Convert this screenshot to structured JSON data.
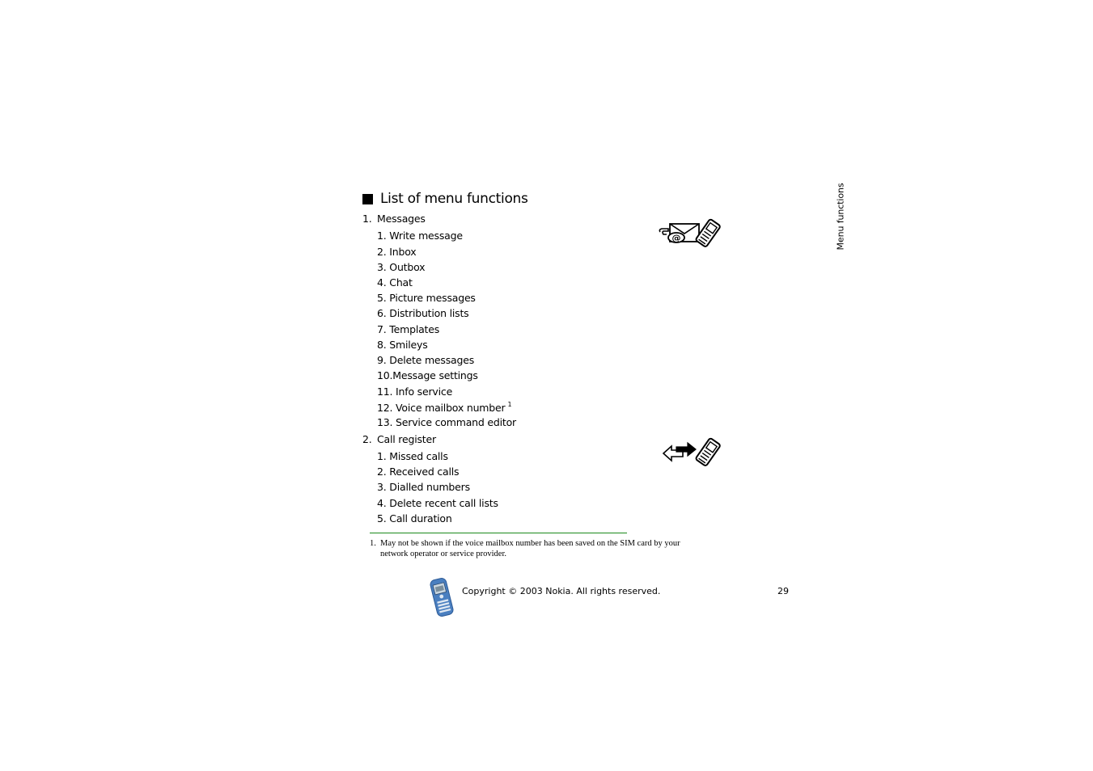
{
  "heading": "List of menu functions",
  "side_tab": "Menu functions",
  "sections": [
    {
      "number": "1.",
      "title": "Messages",
      "icon": "messages-envelope-phone-icon",
      "items": [
        {
          "label": "1. Write message"
        },
        {
          "label": "2. Inbox"
        },
        {
          "label": "3. Outbox"
        },
        {
          "label": "4. Chat"
        },
        {
          "label": "5. Picture messages"
        },
        {
          "label": "6. Distribution lists"
        },
        {
          "label": "7. Templates"
        },
        {
          "label": "8. Smileys"
        },
        {
          "label": "9. Delete messages"
        },
        {
          "label": "10.Message settings"
        },
        {
          "label": "11. Info service"
        },
        {
          "label": "12. Voice mailbox number",
          "footnote_ref": "1"
        },
        {
          "label": "13. Service command editor"
        }
      ]
    },
    {
      "number": "2.",
      "title": "Call register",
      "icon": "call-register-arrows-phone-icon",
      "items": [
        {
          "label": "1. Missed calls"
        },
        {
          "label": "2. Received calls"
        },
        {
          "label": "3. Dialled numbers"
        },
        {
          "label": "4. Delete recent call lists"
        },
        {
          "label": "5. Call duration"
        }
      ]
    }
  ],
  "footnote": {
    "number": "1.",
    "text": "May not be shown if the voice mailbox number has been saved on the SIM card by your network operator or service provider."
  },
  "footer": {
    "copyright": "Copyright © 2003 Nokia. All rights reserved.",
    "page_number": "29"
  },
  "colors": {
    "footnote_rule": "#1a8a1a",
    "phone_blue": "#4a7fc0"
  }
}
